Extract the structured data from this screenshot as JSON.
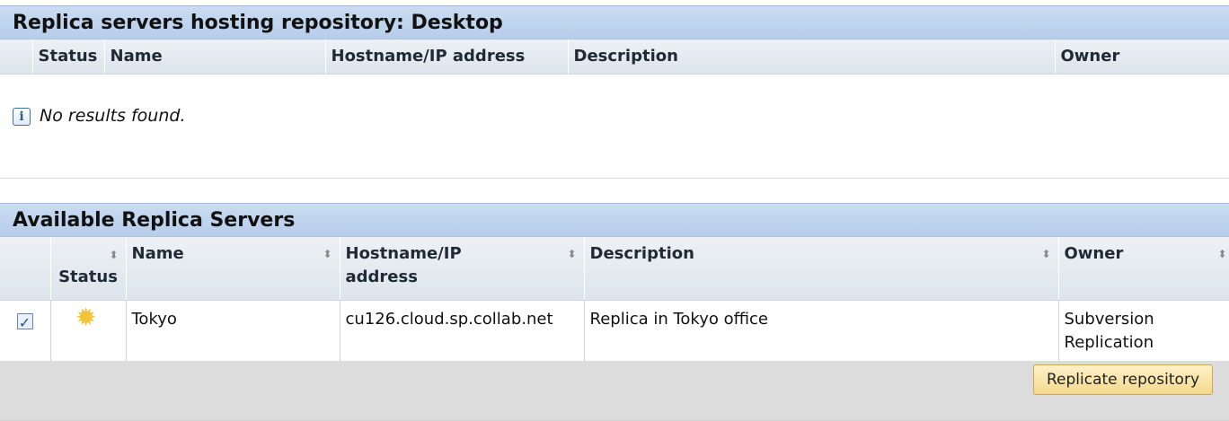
{
  "hosting_panel": {
    "title": "Replica servers hosting repository: Desktop",
    "columns": [
      "Status",
      "Name",
      "Hostname/IP address",
      "Description",
      "Owner"
    ],
    "empty_message": "No results found."
  },
  "available_panel": {
    "title": "Available Replica Servers",
    "columns": {
      "status": "Status",
      "name": "Name",
      "hostname_line1": "Hostname/IP",
      "hostname_line2": "address",
      "description": "Description",
      "owner": "Owner"
    },
    "rows": [
      {
        "checked": true,
        "status_icon": "sun-icon",
        "name": "Tokyo",
        "hostname": "cu126.cloud.sp.collab.net",
        "description": "Replica in Tokyo office",
        "owner_line1": "Subversion",
        "owner_line2": "Replication"
      }
    ],
    "button_label": "Replicate repository"
  },
  "colors": {
    "header_bg": "#c3d7ef",
    "button_bg": "#f7dfa0",
    "status_icon": "#f2c437"
  }
}
